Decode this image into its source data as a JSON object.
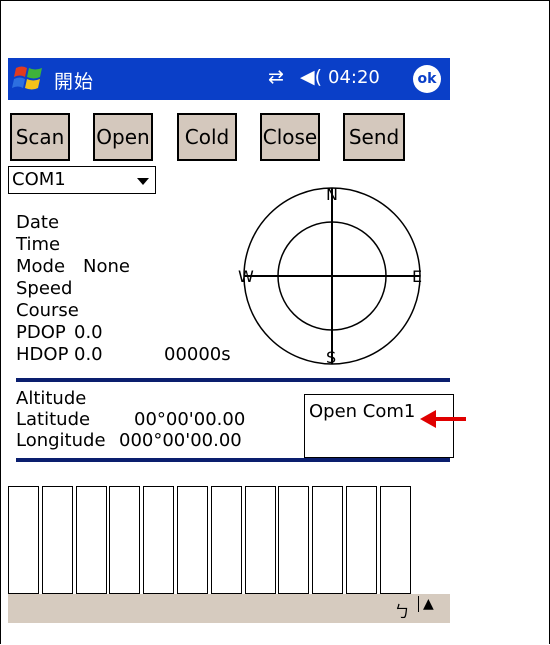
{
  "titlebar": {
    "title": "開始",
    "time": "04:20",
    "ok_label": "ok",
    "connectivity_icon": "connectivity-icon",
    "volume_icon": "speaker-icon",
    "bg_color": "#0a3fc8"
  },
  "toolbar": {
    "scan": "Scan",
    "open": "Open",
    "cold": "Cold",
    "close": "Close",
    "send": "Send"
  },
  "port": {
    "selected": "COM1"
  },
  "gps": {
    "date_label": "Date",
    "time_label": "Time",
    "mode_label": "Mode",
    "mode_value": "None",
    "speed_label": "Speed",
    "course_label": "Course",
    "pdop_label": "PDOP",
    "pdop_value": "0.0",
    "hdop_label": "HDOP",
    "hdop_value": "0.0",
    "elapsed": "00000s"
  },
  "compass": {
    "n": "N",
    "s": "S",
    "e": "E",
    "w": "W"
  },
  "position": {
    "altitude_label": "Altitude",
    "latitude_label": "Latitude",
    "latitude_value": "00°00'00.00",
    "longitude_label": "Longitude",
    "longitude_value": "000°00'00.00"
  },
  "status": {
    "message": "Open Com1"
  },
  "signal_bar_count": 12,
  "accent_color": "#0a1e6e",
  "annotation_color": "#e00000"
}
